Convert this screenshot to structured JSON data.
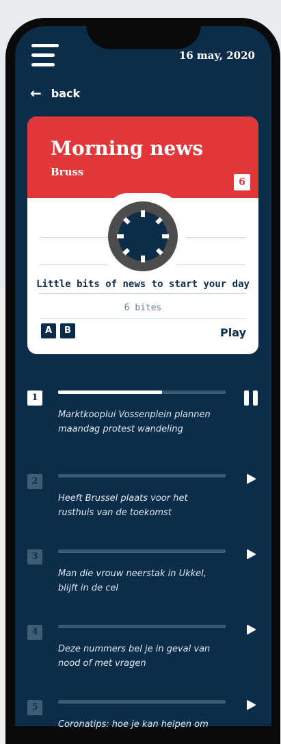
{
  "header": {
    "date": "16 may, 2020",
    "back_label": "back"
  },
  "card": {
    "title": "Morning news",
    "subtitle": "Bruss",
    "count": "6",
    "tagline": "Little bits of news to start your day",
    "bites": "6 bites",
    "badges": [
      "A",
      "B"
    ],
    "play_label": "Play"
  },
  "colors": {
    "background": "#0c2d4a",
    "accent": "#e0373b",
    "progress": "#ffffff"
  },
  "items": [
    {
      "num": "1",
      "title": "Marktkooplui Vossenplein plannen maandag protest wandeling",
      "progress": 0.62,
      "state": "playing"
    },
    {
      "num": "2",
      "title": "Heeft Brussel plaats voor het rusthuis van de toekomst",
      "progress": 0,
      "state": "paused"
    },
    {
      "num": "3",
      "title": "Man die vrouw neerstak in Ukkel, blijft in de cel",
      "progress": 0,
      "state": "paused"
    },
    {
      "num": "4",
      "title": "Deze nummers bel je in geval van nood of met vragen",
      "progress": 0,
      "state": "paused"
    },
    {
      "num": "5",
      "title": "Coronatips: hoe je kan helpen om",
      "progress": 0,
      "state": "paused"
    }
  ]
}
